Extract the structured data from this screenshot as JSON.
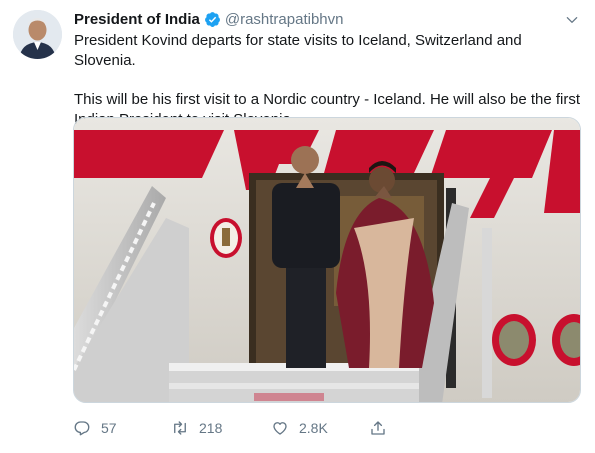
{
  "tweet": {
    "author_name": "President of India",
    "handle": "@rashtrapatibhvn",
    "verified": true,
    "text_line_1": "President Kovind departs for state visits to Iceland, Switzerland and Slovenia.",
    "text_line_2": "This will be his first visit to a Nordic country - Iceland. He will also be the first Indian President to visit Slovenia."
  },
  "actions": {
    "replies": "57",
    "retweets": "218",
    "likes": "2.8K"
  },
  "colors": {
    "verified_blue": "#1da1f2",
    "muted_text": "#657786",
    "aircraft_red": "#c8102e"
  },
  "icons": {
    "caret": "chevron-down-icon",
    "reply": "reply-icon",
    "retweet": "retweet-icon",
    "like": "heart-icon",
    "share": "share-icon",
    "verified": "verified-badge-icon"
  }
}
